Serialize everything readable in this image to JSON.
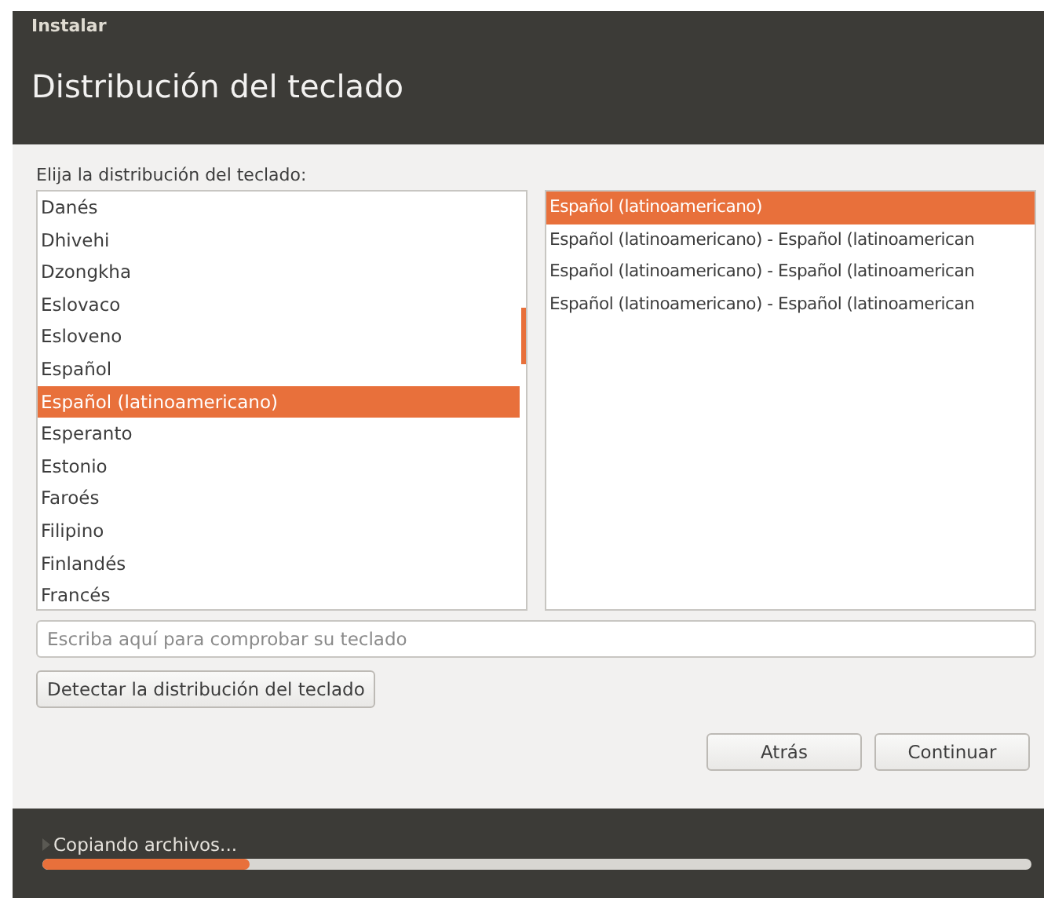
{
  "window": {
    "title": "Instalar"
  },
  "header": {
    "title": "Distribución del teclado"
  },
  "layout_label": "Elija la distribución del teclado:",
  "layouts": [
    {
      "label": "Danés",
      "selected": false
    },
    {
      "label": "Dhivehi",
      "selected": false
    },
    {
      "label": "Dzongkha",
      "selected": false
    },
    {
      "label": "Eslovaco",
      "selected": false
    },
    {
      "label": "Esloveno",
      "selected": false
    },
    {
      "label": "Español",
      "selected": false
    },
    {
      "label": "Español (latinoamericano)",
      "selected": true
    },
    {
      "label": "Esperanto",
      "selected": false
    },
    {
      "label": "Estonio",
      "selected": false
    },
    {
      "label": "Faroés",
      "selected": false
    },
    {
      "label": "Filipino",
      "selected": false
    },
    {
      "label": "Finlandés",
      "selected": false
    },
    {
      "label": "Francés",
      "selected": false
    }
  ],
  "variants": [
    {
      "label": "Español (latinoamericano)",
      "selected": true
    },
    {
      "label": "Español (latinoamericano) - Español (latinoamerican",
      "selected": false
    },
    {
      "label": "Español (latinoamericano) - Español (latinoamerican",
      "selected": false
    },
    {
      "label": "Español (latinoamericano) - Español (latinoamerican",
      "selected": false
    }
  ],
  "test_field": {
    "placeholder": "Escriba aquí para comprobar su teclado"
  },
  "detect_button": "Detectar la distribución del teclado",
  "buttons": [
    "Atrás",
    "Continuar"
  ],
  "status": {
    "text": "Copiando archivos...",
    "level": 0.21
  }
}
